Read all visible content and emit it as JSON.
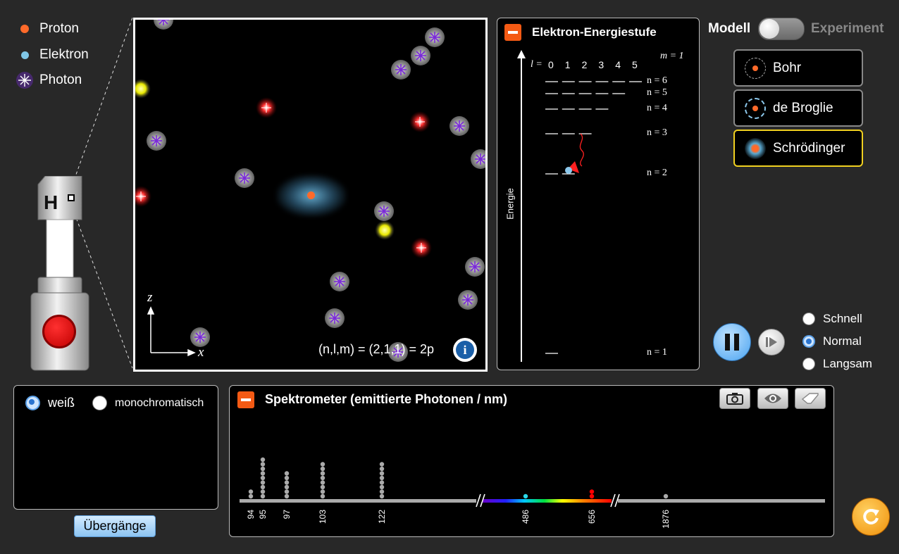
{
  "legend": {
    "items": [
      {
        "label": "Proton",
        "color": "#ff6a2a"
      },
      {
        "label": "Elektron",
        "color": "#7fc6e6"
      },
      {
        "label": "Photon",
        "color": "#8a3cd8"
      }
    ]
  },
  "gun": {
    "label": "H"
  },
  "view": {
    "axis_z": "z",
    "axis_x": "x",
    "state_text": "(n,l,m) = (2,1,1) = 2p",
    "info_icon": "info-icon"
  },
  "energy_panel": {
    "title": "Elektron-Energiestufe",
    "l_label": "l =",
    "l_values": [
      "0",
      "1",
      "2",
      "3",
      "4",
      "5"
    ],
    "m_label": "m = 1",
    "axis_label": "Energie",
    "levels": [
      {
        "label": "n = 6",
        "count": 6
      },
      {
        "label": "n = 5",
        "count": 5
      },
      {
        "label": "n = 4",
        "count": 4
      },
      {
        "label": "n = 3",
        "count": 3
      },
      {
        "label": "n = 2",
        "count": 2
      },
      {
        "label": "n = 1",
        "count": 1
      }
    ]
  },
  "mode_toggle": {
    "left": "Modell",
    "right": "Experiment"
  },
  "models": [
    {
      "label": "Bohr",
      "selected": false
    },
    {
      "label": "de Broglie",
      "selected": false
    },
    {
      "label": "Schrödinger",
      "selected": true
    }
  ],
  "speed": {
    "options": [
      {
        "label": "Schnell",
        "selected": false
      },
      {
        "label": "Normal",
        "selected": true
      },
      {
        "label": "Langsam",
        "selected": false
      }
    ]
  },
  "light_panel": {
    "options": [
      {
        "label": "weiß",
        "selected": true
      },
      {
        "label": "monochromatisch",
        "selected": false
      }
    ],
    "transitions_button": "Übergänge"
  },
  "spectrometer": {
    "title": "Spektrometer (emittierte Photonen / nm)",
    "peaks": [
      {
        "nm": "94",
        "count": 2,
        "color": "#aaaaaa"
      },
      {
        "nm": "95",
        "count": 9,
        "color": "#aaaaaa"
      },
      {
        "nm": "97",
        "count": 6,
        "color": "#aaaaaa"
      },
      {
        "nm": "103",
        "count": 8,
        "color": "#aaaaaa"
      },
      {
        "nm": "122",
        "count": 8,
        "color": "#aaaaaa"
      },
      {
        "nm": "486",
        "count": 1,
        "color": "#2ad8e8"
      },
      {
        "nm": "656",
        "count": 2,
        "color": "#ff0000"
      },
      {
        "nm": "1876",
        "count": 1,
        "color": "#aaaaaa"
      }
    ]
  },
  "colors": {
    "accent_orange": "#f45a14",
    "selected_yellow": "#f0d020",
    "play_blue": "#4aa3f0"
  }
}
